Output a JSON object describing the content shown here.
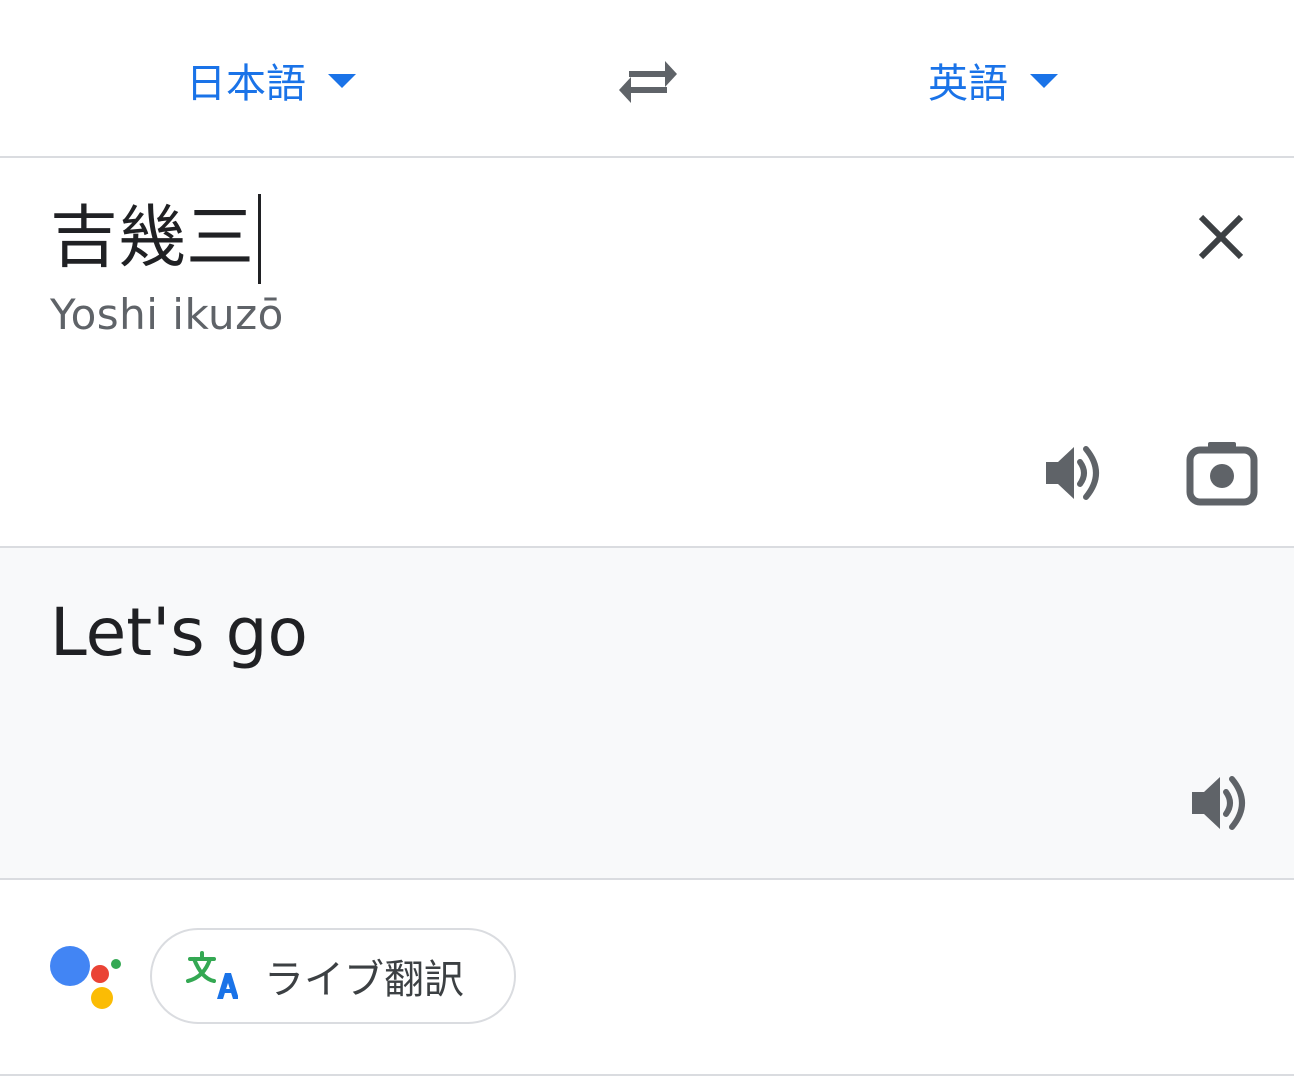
{
  "language_bar": {
    "source_language": "日本語",
    "target_language": "英語"
  },
  "source": {
    "text": "吉幾三",
    "romanization": "Yoshi ikuzō"
  },
  "result": {
    "text": "Let's go"
  },
  "bottom": {
    "live_translate_label": "ライブ翻訳"
  },
  "icons": {
    "swap": "swap-arrows-icon",
    "clear": "close-icon",
    "speak": "speaker-icon",
    "camera": "camera-icon",
    "assistant": "google-assistant-icon",
    "translate": "translate-icon"
  },
  "colors": {
    "accent": "#1a73e8",
    "icon_gray": "#5f6368",
    "divider": "#dadce0",
    "result_bg": "#f8f9fa",
    "assistant_blue": "#4285f4",
    "assistant_red": "#ea4335",
    "assistant_yellow": "#fbbc04",
    "assistant_green": "#34a853"
  }
}
